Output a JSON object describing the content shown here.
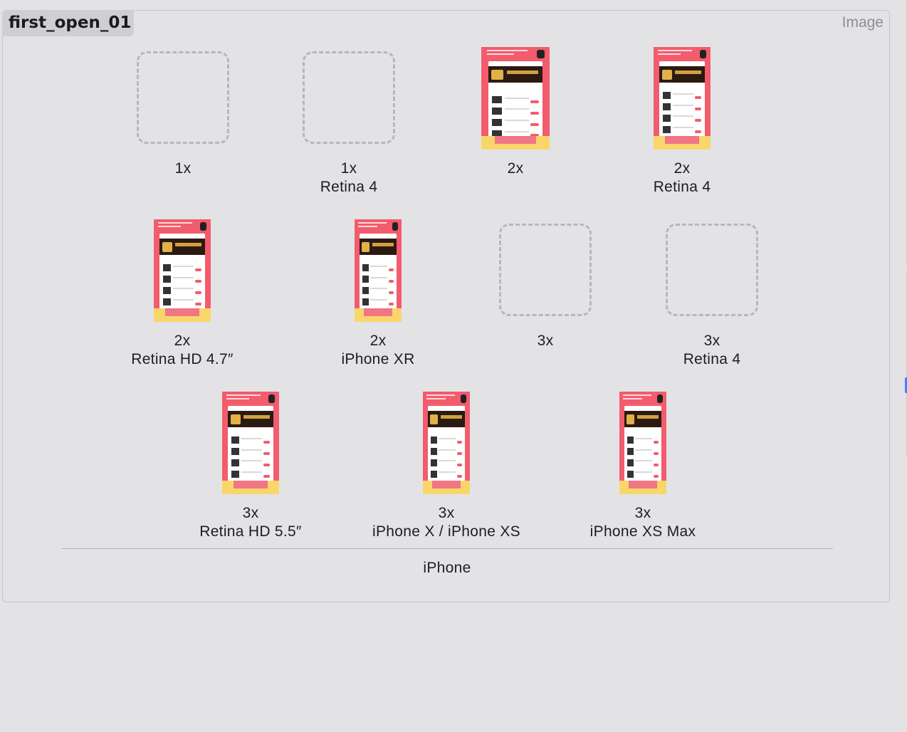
{
  "image_set": {
    "name": "first_open_01",
    "type_label": "Image"
  },
  "device_group": "iPhone",
  "slots": [
    {
      "scale": "1x",
      "device": "",
      "state": "empty"
    },
    {
      "scale": "1x",
      "device": "Retina 4",
      "state": "empty"
    },
    {
      "scale": "2x",
      "device": "",
      "state": "filled"
    },
    {
      "scale": "2x",
      "device": "Retina 4",
      "state": "filled"
    },
    {
      "scale": "2x",
      "device": "Retina HD 4.7″",
      "state": "filled"
    },
    {
      "scale": "2x",
      "device": "iPhone XR",
      "state": "filled"
    },
    {
      "scale": "3x",
      "device": "",
      "state": "empty"
    },
    {
      "scale": "3x",
      "device": "Retina 4",
      "state": "empty"
    },
    {
      "scale": "3x",
      "device": "Retina HD 5.5″",
      "state": "filled"
    },
    {
      "scale": "3x",
      "device": "iPhone X / iPhone XS",
      "state": "filled"
    },
    {
      "scale": "3x",
      "device": "iPhone XS Max",
      "state": "filled"
    }
  ],
  "colors": {
    "background": "#e3e3e6",
    "thumb_pink": "#f25c6c",
    "thumb_yellow": "#f9d66a",
    "accent": "#3a84ff"
  }
}
